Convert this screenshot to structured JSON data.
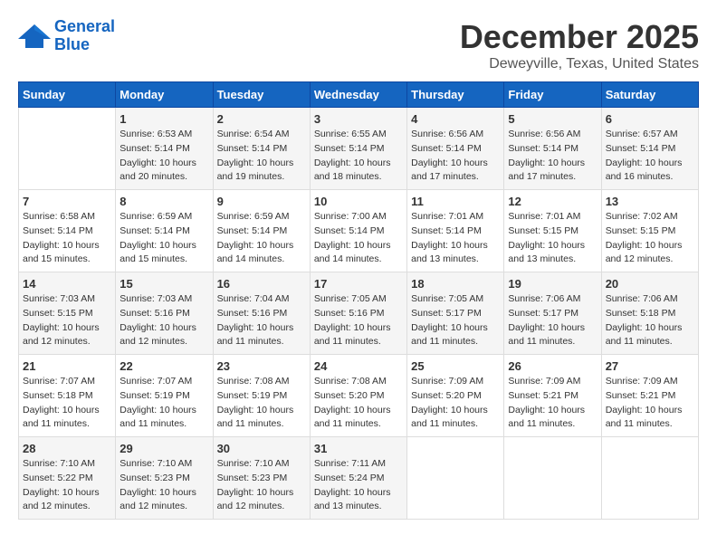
{
  "logo": {
    "line1": "General",
    "line2": "Blue"
  },
  "title": {
    "month": "December 2025",
    "location": "Deweyville, Texas, United States"
  },
  "days_of_week": [
    "Sunday",
    "Monday",
    "Tuesday",
    "Wednesday",
    "Thursday",
    "Friday",
    "Saturday"
  ],
  "weeks": [
    [
      {
        "day": "",
        "info": ""
      },
      {
        "day": "1",
        "info": "Sunrise: 6:53 AM\nSunset: 5:14 PM\nDaylight: 10 hours\nand 20 minutes."
      },
      {
        "day": "2",
        "info": "Sunrise: 6:54 AM\nSunset: 5:14 PM\nDaylight: 10 hours\nand 19 minutes."
      },
      {
        "day": "3",
        "info": "Sunrise: 6:55 AM\nSunset: 5:14 PM\nDaylight: 10 hours\nand 18 minutes."
      },
      {
        "day": "4",
        "info": "Sunrise: 6:56 AM\nSunset: 5:14 PM\nDaylight: 10 hours\nand 17 minutes."
      },
      {
        "day": "5",
        "info": "Sunrise: 6:56 AM\nSunset: 5:14 PM\nDaylight: 10 hours\nand 17 minutes."
      },
      {
        "day": "6",
        "info": "Sunrise: 6:57 AM\nSunset: 5:14 PM\nDaylight: 10 hours\nand 16 minutes."
      }
    ],
    [
      {
        "day": "7",
        "info": "Sunrise: 6:58 AM\nSunset: 5:14 PM\nDaylight: 10 hours\nand 15 minutes."
      },
      {
        "day": "8",
        "info": "Sunrise: 6:59 AM\nSunset: 5:14 PM\nDaylight: 10 hours\nand 15 minutes."
      },
      {
        "day": "9",
        "info": "Sunrise: 6:59 AM\nSunset: 5:14 PM\nDaylight: 10 hours\nand 14 minutes."
      },
      {
        "day": "10",
        "info": "Sunrise: 7:00 AM\nSunset: 5:14 PM\nDaylight: 10 hours\nand 14 minutes."
      },
      {
        "day": "11",
        "info": "Sunrise: 7:01 AM\nSunset: 5:14 PM\nDaylight: 10 hours\nand 13 minutes."
      },
      {
        "day": "12",
        "info": "Sunrise: 7:01 AM\nSunset: 5:15 PM\nDaylight: 10 hours\nand 13 minutes."
      },
      {
        "day": "13",
        "info": "Sunrise: 7:02 AM\nSunset: 5:15 PM\nDaylight: 10 hours\nand 12 minutes."
      }
    ],
    [
      {
        "day": "14",
        "info": "Sunrise: 7:03 AM\nSunset: 5:15 PM\nDaylight: 10 hours\nand 12 minutes."
      },
      {
        "day": "15",
        "info": "Sunrise: 7:03 AM\nSunset: 5:16 PM\nDaylight: 10 hours\nand 12 minutes."
      },
      {
        "day": "16",
        "info": "Sunrise: 7:04 AM\nSunset: 5:16 PM\nDaylight: 10 hours\nand 11 minutes."
      },
      {
        "day": "17",
        "info": "Sunrise: 7:05 AM\nSunset: 5:16 PM\nDaylight: 10 hours\nand 11 minutes."
      },
      {
        "day": "18",
        "info": "Sunrise: 7:05 AM\nSunset: 5:17 PM\nDaylight: 10 hours\nand 11 minutes."
      },
      {
        "day": "19",
        "info": "Sunrise: 7:06 AM\nSunset: 5:17 PM\nDaylight: 10 hours\nand 11 minutes."
      },
      {
        "day": "20",
        "info": "Sunrise: 7:06 AM\nSunset: 5:18 PM\nDaylight: 10 hours\nand 11 minutes."
      }
    ],
    [
      {
        "day": "21",
        "info": "Sunrise: 7:07 AM\nSunset: 5:18 PM\nDaylight: 10 hours\nand 11 minutes."
      },
      {
        "day": "22",
        "info": "Sunrise: 7:07 AM\nSunset: 5:19 PM\nDaylight: 10 hours\nand 11 minutes."
      },
      {
        "day": "23",
        "info": "Sunrise: 7:08 AM\nSunset: 5:19 PM\nDaylight: 10 hours\nand 11 minutes."
      },
      {
        "day": "24",
        "info": "Sunrise: 7:08 AM\nSunset: 5:20 PM\nDaylight: 10 hours\nand 11 minutes."
      },
      {
        "day": "25",
        "info": "Sunrise: 7:09 AM\nSunset: 5:20 PM\nDaylight: 10 hours\nand 11 minutes."
      },
      {
        "day": "26",
        "info": "Sunrise: 7:09 AM\nSunset: 5:21 PM\nDaylight: 10 hours\nand 11 minutes."
      },
      {
        "day": "27",
        "info": "Sunrise: 7:09 AM\nSunset: 5:21 PM\nDaylight: 10 hours\nand 11 minutes."
      }
    ],
    [
      {
        "day": "28",
        "info": "Sunrise: 7:10 AM\nSunset: 5:22 PM\nDaylight: 10 hours\nand 12 minutes."
      },
      {
        "day": "29",
        "info": "Sunrise: 7:10 AM\nSunset: 5:23 PM\nDaylight: 10 hours\nand 12 minutes."
      },
      {
        "day": "30",
        "info": "Sunrise: 7:10 AM\nSunset: 5:23 PM\nDaylight: 10 hours\nand 12 minutes."
      },
      {
        "day": "31",
        "info": "Sunrise: 7:11 AM\nSunset: 5:24 PM\nDaylight: 10 hours\nand 13 minutes."
      },
      {
        "day": "",
        "info": ""
      },
      {
        "day": "",
        "info": ""
      },
      {
        "day": "",
        "info": ""
      }
    ]
  ]
}
